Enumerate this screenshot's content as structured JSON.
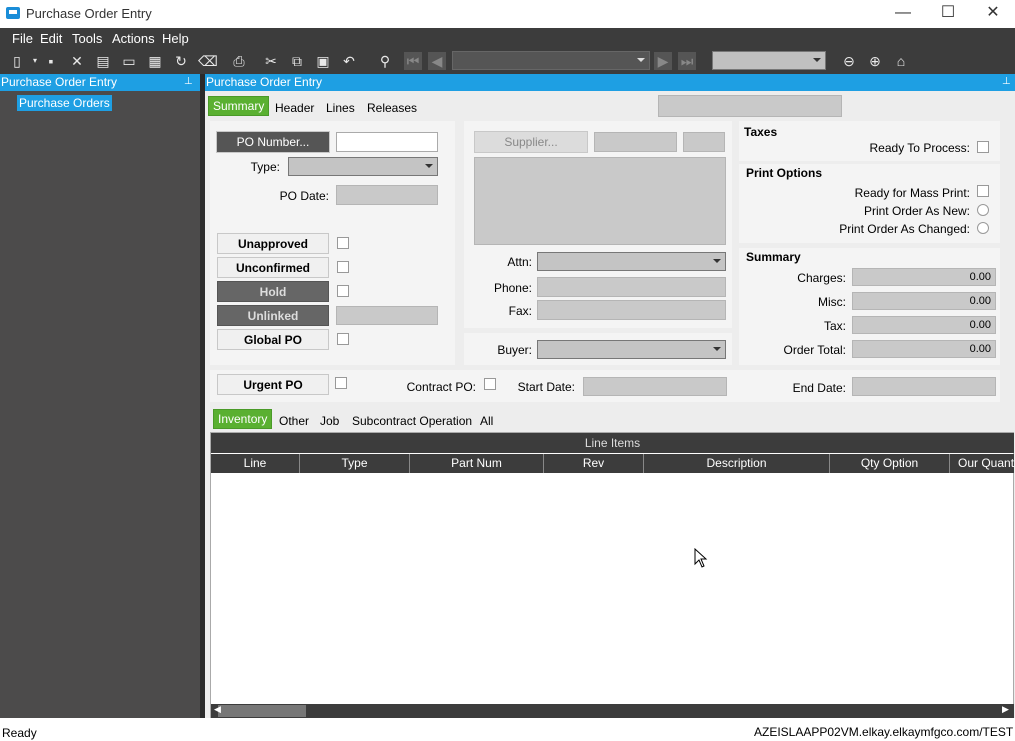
{
  "window": {
    "title": "Purchase Order Entry",
    "minimize": "—",
    "maximize": "☐",
    "close": "✕"
  },
  "menu": [
    "File",
    "Edit",
    "Tools",
    "Actions",
    "Help"
  ],
  "left": {
    "header": "Purchase Order Entry",
    "tree_item": "Purchase Orders"
  },
  "main": {
    "header": "Purchase Order Entry",
    "tabs": [
      "Summary",
      "Header",
      "Lines",
      "Releases"
    ],
    "po_number_btn": "PO Number...",
    "type_label": "Type:",
    "po_date_label": "PO Date:",
    "unapproved": "Unapproved",
    "unconfirmed": "Unconfirmed",
    "hold": "Hold",
    "unlinked": "Unlinked",
    "global_po": "Global PO",
    "urgent_po": "Urgent PO",
    "contract_po": "Contract PO:",
    "start_date": "Start Date:",
    "end_date": "End Date:",
    "supplier_btn": "Supplier...",
    "attn": "Attn:",
    "phone": "Phone:",
    "fax": "Fax:",
    "buyer": "Buyer:",
    "taxes": "Taxes",
    "ready_to_process": "Ready To Process:",
    "print_options": "Print Options",
    "ready_mass_print": "Ready for Mass Print:",
    "print_new": "Print Order As New:",
    "print_changed": "Print Order As Changed:",
    "summary": "Summary",
    "charges": "Charges:",
    "misc": "Misc:",
    "tax": "Tax:",
    "order_total": "Order Total:",
    "charges_val": "0.00",
    "misc_val": "0.00",
    "tax_val": "0.00",
    "total_val": "0.00"
  },
  "subtabs": [
    "Inventory",
    "Other",
    "Job",
    "Subcontract Operation",
    "All"
  ],
  "grid": {
    "title": "Line Items",
    "columns": [
      "Line",
      "Type",
      "Part Num",
      "Rev",
      "Description",
      "Qty Option",
      "Our Quanti"
    ]
  },
  "status": {
    "left": "Ready",
    "right": "AZEISLAAPP02VM.elkay.elkaymfgco.com/TEST"
  }
}
